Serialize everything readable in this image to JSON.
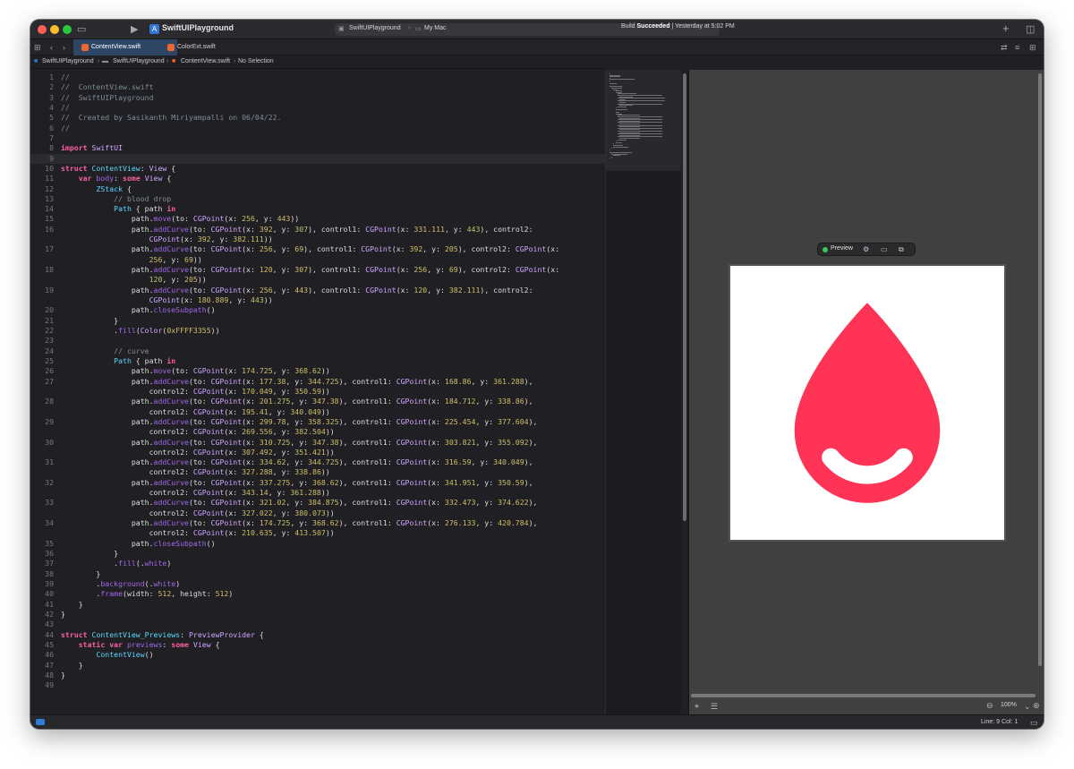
{
  "window": {
    "title": "SwiftUIPlayground",
    "scheme": "SwiftUIPlayground",
    "destination": "My Mac",
    "build_status_prefix": "Build ",
    "build_status_result": "Succeeded",
    "build_status_time": " | Yesterday at 5:02 PM"
  },
  "icons": {
    "sidebar": "sidebar-toggle-icon",
    "run": "play-icon",
    "add": "plus-icon",
    "inspector": "inspector-toggle-icon"
  },
  "tabs": [
    {
      "label": "ContentView.swift",
      "active": true
    },
    {
      "label": "ColorExt.swift",
      "active": false
    }
  ],
  "breadcrumb": [
    "SwiftUIPlayground",
    "SwiftUIPlayground",
    "ContentView.swift",
    "No Selection"
  ],
  "editor": {
    "current_line": 9,
    "lines": [
      "//",
      "//  ContentView.swift",
      "//  SwiftUIPlayground",
      "//",
      "//  Created by Sasikanth Miriyampalli on 06/04/22.",
      "//",
      "",
      "import SwiftUI",
      "",
      "struct ContentView: View {",
      "    var body: some View {",
      "        ZStack {",
      "            // blood drop",
      "            Path { path in",
      "                path.move(to: CGPoint(x: 256, y: 443))",
      "                path.addCurve(to: CGPoint(x: 392, y: 307), control1: CGPoint(x: 331.111, y: 443), control2:\n                    CGPoint(x: 392, y: 382.111))",
      "                path.addCurve(to: CGPoint(x: 256, y: 69), control1: CGPoint(x: 392, y: 205), control2: CGPoint(x:\n                    256, y: 69))",
      "                path.addCurve(to: CGPoint(x: 120, y: 307), control1: CGPoint(x: 256, y: 69), control2: CGPoint(x:\n                    120, y: 205))",
      "                path.addCurve(to: CGPoint(x: 256, y: 443), control1: CGPoint(x: 120, y: 382.111), control2:\n                    CGPoint(x: 180.889, y: 443))",
      "                path.closeSubpath()",
      "            }",
      "            .fill(Color(0xFFFF3355))",
      "",
      "            // curve",
      "            Path { path in",
      "                path.move(to: CGPoint(x: 174.725, y: 368.62))",
      "                path.addCurve(to: CGPoint(x: 177.38, y: 344.725), control1: CGPoint(x: 168.86, y: 361.288),\n                    control2: CGPoint(x: 170.049, y: 350.59))",
      "                path.addCurve(to: CGPoint(x: 201.275, y: 347.38), control1: CGPoint(x: 184.712, y: 338.86),\n                    control2: CGPoint(x: 195.41, y: 340.049))",
      "                path.addCurve(to: CGPoint(x: 299.78, y: 358.325), control1: CGPoint(x: 225.454, y: 377.604),\n                    control2: CGPoint(x: 269.556, y: 382.504))",
      "                path.addCurve(to: CGPoint(x: 310.725, y: 347.38), control1: CGPoint(x: 303.821, y: 355.092),\n                    control2: CGPoint(x: 307.492, y: 351.421))",
      "                path.addCurve(to: CGPoint(x: 334.62, y: 344.725), control1: CGPoint(x: 316.59, y: 340.049),\n                    control2: CGPoint(x: 327.288, y: 338.86))",
      "                path.addCurve(to: CGPoint(x: 337.275, y: 368.62), control1: CGPoint(x: 341.951, y: 350.59),\n                    control2: CGPoint(x: 343.14, y: 361.288))",
      "                path.addCurve(to: CGPoint(x: 321.02, y: 384.875), control1: CGPoint(x: 332.473, y: 374.622),\n                    control2: CGPoint(x: 327.022, y: 380.073))",
      "                path.addCurve(to: CGPoint(x: 174.725, y: 368.62), control1: CGPoint(x: 276.133, y: 420.784),\n                    control2: CGPoint(x: 210.635, y: 413.507))",
      "                path.closeSubpath()",
      "            }",
      "            .fill(.white)",
      "        }",
      "        .background(.white)",
      "        .frame(width: 512, height: 512)",
      "    }",
      "}",
      "",
      "struct ContentView_Previews: PreviewProvider {",
      "    static var previews: some View {",
      "        ContentView()",
      "    }",
      "}",
      ""
    ]
  },
  "preview": {
    "label": "Preview",
    "zoom": "100%",
    "drop_color": "#FF3355",
    "background": "#FFFFFF"
  },
  "status": {
    "position": "Line: 9  Col: 1"
  }
}
